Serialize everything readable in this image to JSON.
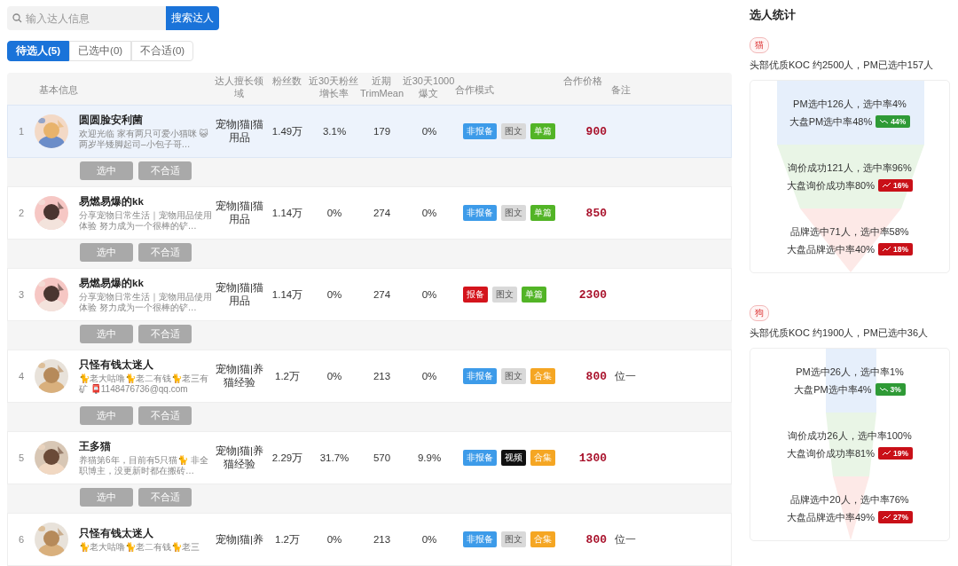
{
  "search": {
    "placeholder": "输入达人信息",
    "button": "搜索达人"
  },
  "tabs": [
    {
      "label": "待选人(5)",
      "selected": true
    },
    {
      "label": "已选中(0)",
      "selected": false
    },
    {
      "label": "不合适(0)",
      "selected": false
    }
  ],
  "table": {
    "columns": [
      "基本信息",
      "达人擅长领域",
      "粉丝数",
      "近30天粉丝增长率",
      "近期TrimMean",
      "近30天1000爆文",
      "合作模式",
      "合作价格",
      "备注"
    ],
    "rows": [
      {
        "index": "1",
        "name": "圆圆脸安利菌",
        "bio": "欢迎光临 家有两只可爱小猫咪 😺 两岁半矮脚起司–小包子哥…",
        "category": "宠物|猫|猫用品",
        "fans": "1.49万",
        "growth": "3.1%",
        "trim": "179",
        "burst": "0%",
        "tags": [
          {
            "label": "非报备",
            "color": "#3d9be9"
          },
          {
            "label": "图文",
            "color": "#d9d9d9"
          },
          {
            "label": "单篇",
            "color": "#52b426"
          }
        ],
        "price": "900",
        "remark": "",
        "highlighted": true,
        "actions": [
          "选中",
          "不合适"
        ]
      },
      {
        "index": "2",
        "name": "易燃易爆的kk",
        "bio": "分享宠物日常生活｜宠物用品使用体验 努力成为一个很棒的铲…",
        "category": "宠物|猫|猫用品",
        "fans": "1.14万",
        "growth": "0%",
        "trim": "274",
        "burst": "0%",
        "tags": [
          {
            "label": "非报备",
            "color": "#3d9be9"
          },
          {
            "label": "图文",
            "color": "#d9d9d9"
          },
          {
            "label": "单篇",
            "color": "#52b426"
          }
        ],
        "price": "850",
        "remark": "",
        "highlighted": false,
        "actions": [
          "选中",
          "不合适"
        ]
      },
      {
        "index": "3",
        "name": "易燃易爆的kk",
        "bio": "分享宠物日常生活｜宠物用品使用体验 努力成为一个很棒的铲…",
        "category": "宠物|猫|猫用品",
        "fans": "1.14万",
        "growth": "0%",
        "trim": "274",
        "burst": "0%",
        "tags": [
          {
            "label": "报备",
            "color": "#d4141c"
          },
          {
            "label": "图文",
            "color": "#d9d9d9"
          },
          {
            "label": "单篇",
            "color": "#52b426"
          }
        ],
        "price": "2300",
        "remark": "",
        "highlighted": false,
        "actions": [
          "选中",
          "不合适"
        ]
      },
      {
        "index": "4",
        "name": "只怪有钱太迷人",
        "bio": "🐈老大咕噜🐈老二有钱🐈老三有矿 📮1148476736@qq.com",
        "category": "宠物|猫|养猫经验",
        "fans": "1.2万",
        "growth": "0%",
        "trim": "213",
        "burst": "0%",
        "tags": [
          {
            "label": "非报备",
            "color": "#3d9be9"
          },
          {
            "label": "图文",
            "color": "#d9d9d9"
          },
          {
            "label": "合集",
            "color": "#f5a623"
          }
        ],
        "price": "800",
        "remark": "位一",
        "highlighted": false,
        "actions": [
          "选中",
          "不合适"
        ]
      },
      {
        "index": "5",
        "name": "王多猫",
        "bio": "养猫第6年，目前有5只猫🐈 非全职博主，没更新时都在搬砖…",
        "category": "宠物|猫|养猫经验",
        "fans": "2.29万",
        "growth": "31.7%",
        "trim": "570",
        "burst": "9.9%",
        "tags": [
          {
            "label": "非报备",
            "color": "#3d9be9"
          },
          {
            "label": "视频",
            "color": "#111111"
          },
          {
            "label": "合集",
            "color": "#f5a623"
          }
        ],
        "price": "1300",
        "remark": "",
        "highlighted": false,
        "actions": [
          "选中",
          "不合适"
        ]
      },
      {
        "index": "6",
        "name": "只怪有钱太迷人",
        "bio": "🐈老大咕噜🐈老二有钱🐈老三",
        "category": "宠物|猫|养",
        "fans": "1.2万",
        "growth": "0%",
        "trim": "213",
        "burst": "0%",
        "tags": [
          {
            "label": "非报备",
            "color": "#3d9be9"
          },
          {
            "label": "图文",
            "color": "#d9d9d9"
          },
          {
            "label": "合集",
            "color": "#f5a623"
          }
        ],
        "price": "800",
        "remark": "位一",
        "highlighted": false
      }
    ]
  },
  "stats": {
    "title": "选人统计",
    "groups": [
      {
        "tag": "猫",
        "summary": "头部优质KOC 约2500人，PM已选中157人",
        "kind": "wide",
        "stages": [
          {
            "line": "PM选中126人，选中率4%",
            "compare": "大盘PM选中率48%",
            "badge": "44%",
            "rising": false
          },
          {
            "line": "询价成功121人，选中率96%",
            "compare": "大盘询价成功率80%",
            "badge": "16%",
            "rising": true
          },
          {
            "line": "品牌选中71人，选中率58%",
            "compare": "大盘品牌选中率40%",
            "badge": "18%",
            "rising": true
          }
        ]
      },
      {
        "tag": "狗",
        "summary": "头部优质KOC 约1900人，PM已选中36人",
        "kind": "narrow",
        "stages": [
          {
            "line": "PM选中26人，选中率1%",
            "compare": "大盘PM选中率4%",
            "badge": "3%",
            "rising": false
          },
          {
            "line": "询价成功26人，选中率100%",
            "compare": "大盘询价成功率81%",
            "badge": "19%",
            "rising": true
          },
          {
            "line": "品牌选中20人，选中率76%",
            "compare": "大盘品牌选中率49%",
            "badge": "27%",
            "rising": true
          }
        ]
      }
    ]
  }
}
